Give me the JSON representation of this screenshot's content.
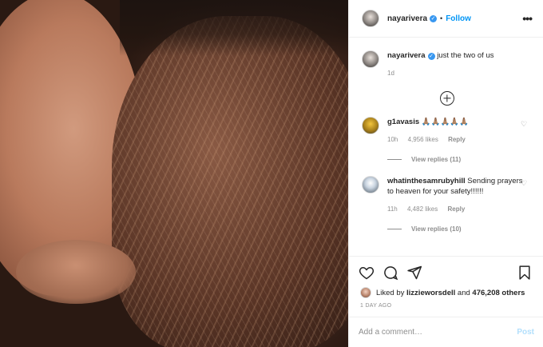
{
  "post": {
    "username": "nayarivera",
    "follow_label": "Follow",
    "dot": "•",
    "more_icon": "more-horizontal-icon",
    "caption": {
      "username": "nayarivera",
      "text": "just the two of us",
      "time": "1d"
    }
  },
  "comments": [
    {
      "username": "g1avasis",
      "text": "🙏🏽🙏🏽🙏🏽🙏🏽🙏🏽",
      "time": "10h",
      "likes": "4,956 likes",
      "reply_label": "Reply",
      "view_replies": "View replies (11)"
    },
    {
      "username": "whatinthesamrubyhill",
      "text": "Sending prayers to heaven for your safety!!!!!!",
      "time": "11h",
      "likes": "4,482 likes",
      "reply_label": "Reply",
      "view_replies": "View replies (10)"
    }
  ],
  "footer": {
    "liked_by_prefix": "Liked by",
    "liked_by_user": "lizzieworsdell",
    "liked_by_and": "and",
    "liked_by_count": "476,208 others",
    "date": "1 DAY AGO",
    "comment_placeholder": "Add a comment…",
    "post_label": "Post"
  },
  "colors": {
    "accent": "#0095f6",
    "verified": "#3897f0",
    "muted": "#8e8e8e",
    "post_disabled": "#b2dffc"
  }
}
